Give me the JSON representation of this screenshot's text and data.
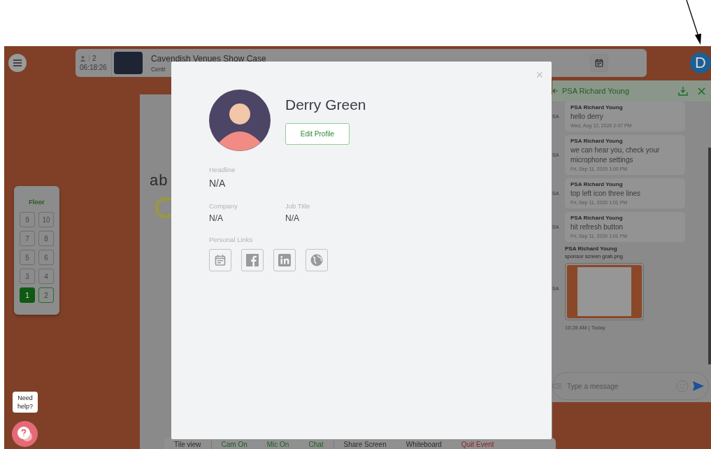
{
  "header": {
    "participants": "2",
    "timer": "06:18:26",
    "title": "Cavendish Venues Show Case",
    "subtitle": "Centr"
  },
  "user_avatar": {
    "initial": "D"
  },
  "floor": {
    "title": "Floor",
    "buttons": [
      {
        "label": "9",
        "selected": false,
        "disabled": true
      },
      {
        "label": "10",
        "selected": false,
        "disabled": true
      },
      {
        "label": "7",
        "selected": false,
        "disabled": true
      },
      {
        "label": "8",
        "selected": false,
        "disabled": true
      },
      {
        "label": "5",
        "selected": false,
        "disabled": true
      },
      {
        "label": "6",
        "selected": false,
        "disabled": true
      },
      {
        "label": "3",
        "selected": false,
        "disabled": true
      },
      {
        "label": "4",
        "selected": false,
        "disabled": true
      },
      {
        "label": "1",
        "selected": true,
        "disabled": false
      },
      {
        "label": "2",
        "selected": false,
        "disabled": false
      }
    ]
  },
  "stage": {
    "logo_text": "ab"
  },
  "toolbar": [
    {
      "label": "Tile view",
      "color": "#2b2b2b",
      "divider_after": true
    },
    {
      "label": "Cam On",
      "color": "#1d5e20",
      "divider_after": false
    },
    {
      "label": "Mic On",
      "color": "#1d5e20",
      "divider_after": false
    },
    {
      "label": "Chat",
      "color": "#1d5e20",
      "divider_after": true
    },
    {
      "label": "Share Screen",
      "color": "#2b2b2b",
      "divider_after": false
    },
    {
      "label": "Whiteboard",
      "color": "#2b2b2b",
      "divider_after": false
    },
    {
      "label": "Quit Event",
      "color": "#8e1f1f",
      "divider_after": false
    }
  ],
  "chat": {
    "title": "PSA Richard Young",
    "messages": [
      {
        "kind": "text",
        "avatar": "SA",
        "sender": "PSA Richard Young",
        "text": "hello derry",
        "time": "Wed, Aug 12, 2020 2:47 PM"
      },
      {
        "kind": "text",
        "avatar": "SA",
        "sender": "PSA Richard Young",
        "text": "we can hear you, check your microphone settings",
        "time": "Fri, Sep 11, 2020 1:00 PM"
      },
      {
        "kind": "text",
        "avatar": "SA",
        "sender": "PSA Richard Young",
        "text": "top left icon three lines",
        "time": "Fri, Sep 11, 2020 1:01 PM"
      },
      {
        "kind": "text",
        "avatar": "SA",
        "sender": "PSA Richard Young",
        "text": "hit refresh button",
        "time": "Fri, Sep 11, 2020 1:01 PM"
      },
      {
        "kind": "file",
        "avatar": "SA",
        "sender": "PSA Richard Young",
        "text": "sponsor screen grab.png",
        "time": "10:28 AM | Today"
      }
    ],
    "input": {
      "placeholder": "Type a message"
    }
  },
  "help": {
    "bubble": "Need help?"
  },
  "profile_modal": {
    "close_glyph": "×",
    "name": "Derry Green",
    "edit_button": "Edit Profile",
    "headline": {
      "label": "Headline",
      "value": "N/A"
    },
    "details": [
      {
        "label": "Company",
        "value": "N/A"
      },
      {
        "label": "Job Title",
        "value": "N/A"
      }
    ],
    "links_label": "Personal Links"
  }
}
